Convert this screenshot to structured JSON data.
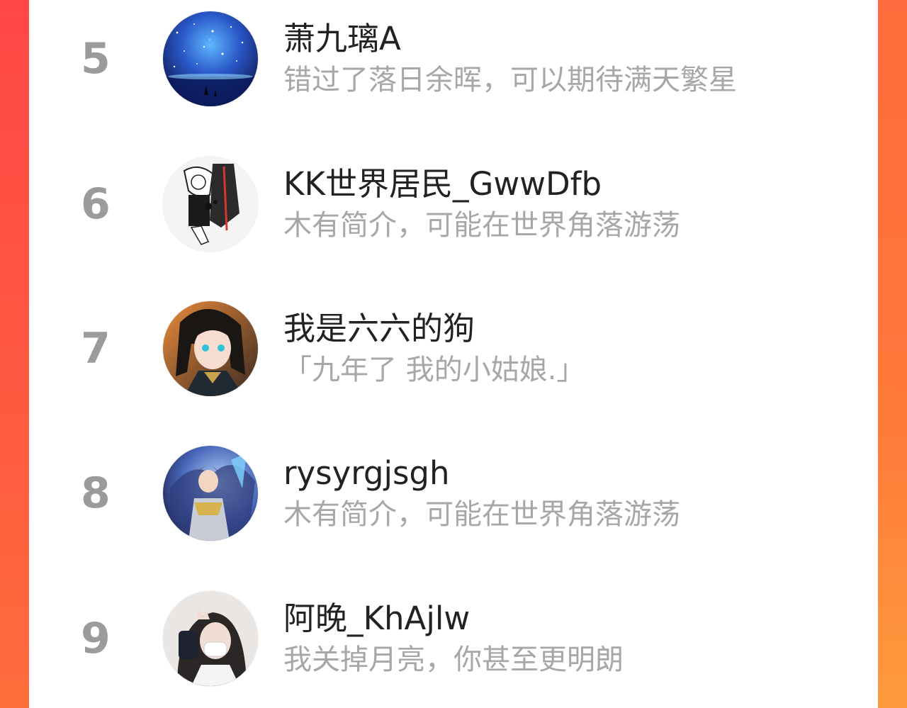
{
  "colors": {
    "frame_gradient_top": "#ff4b45",
    "frame_gradient_bottom": "#ff8a3a",
    "panel": "#ffffff",
    "rank": "#9b9b9b",
    "name": "#222222",
    "bio": "#a7a7a7"
  },
  "ranking": {
    "items": [
      {
        "rank": "5",
        "name": "萧九璃A",
        "bio": "错过了落日余晖，可以期待满天繁星",
        "avatar": "starry-sky-avatar"
      },
      {
        "rank": "6",
        "name": "KK世界居民_GwwDfb",
        "bio": "木有简介，可能在世界角落游荡",
        "avatar": "monochrome-anime-avatar"
      },
      {
        "rank": "7",
        "name": "我是六六的狗",
        "bio": "「九年了 我的小姑娘.」",
        "avatar": "anime-girl-avatar"
      },
      {
        "rank": "8",
        "name": "rysyrgjsgh",
        "bio": "木有简介，可能在世界角落游荡",
        "avatar": "armored-warrior-avatar"
      },
      {
        "rank": "9",
        "name": "阿晚_KhAjlw",
        "bio": "我关掉月亮，你甚至更明朗",
        "avatar": "selfie-girl-avatar"
      }
    ]
  }
}
